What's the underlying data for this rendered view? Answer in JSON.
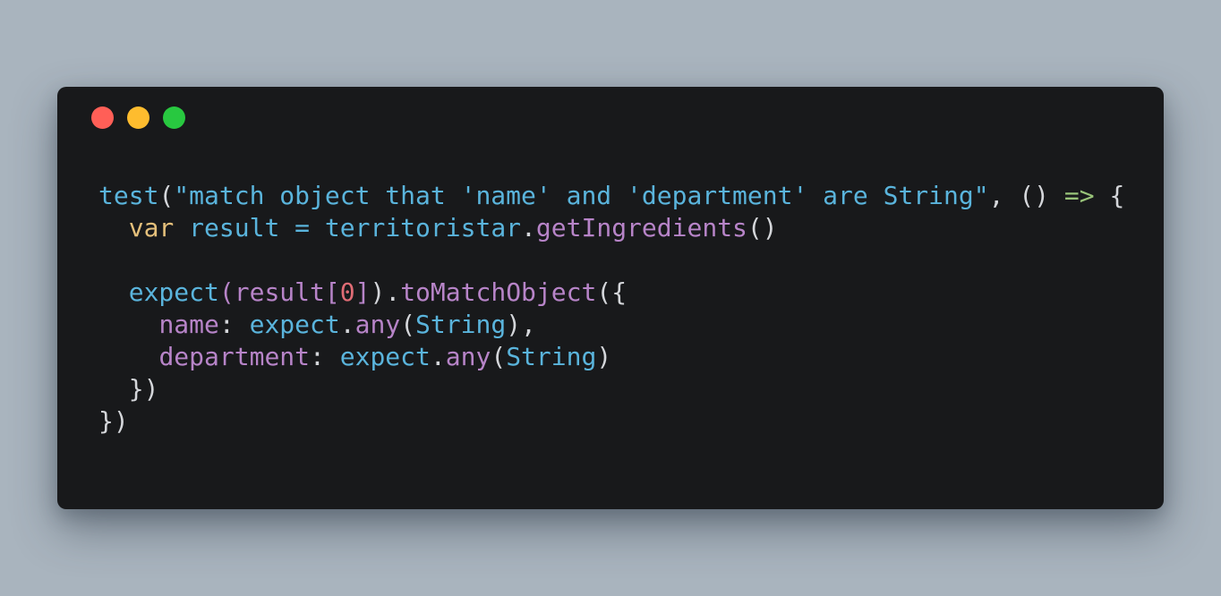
{
  "window": {
    "controls": [
      {
        "name": "close",
        "color": "#ff5f57"
      },
      {
        "name": "minimize",
        "color": "#febc2e"
      },
      {
        "name": "zoom",
        "color": "#28c840"
      }
    ]
  },
  "colors": {
    "background": "#a9b4be",
    "editor_background": "#18191b",
    "plain": "#d4d6da",
    "function": "#5ab4dc",
    "string": "#5ab4dc",
    "keyword": "#e5c07b",
    "method": "#b784c8",
    "arrow": "#98c379",
    "number": "#e06c75"
  },
  "code": {
    "lines": [
      [
        {
          "t": "test",
          "c": "function"
        },
        {
          "t": "(",
          "c": "plain"
        },
        {
          "t": "\"match object that 'name' and 'department' are String\"",
          "c": "string"
        },
        {
          "t": ", () ",
          "c": "plain"
        },
        {
          "t": "=>",
          "c": "arrow"
        },
        {
          "t": " {",
          "c": "plain"
        }
      ],
      [
        {
          "t": "  ",
          "c": "plain"
        },
        {
          "t": "var",
          "c": "keyword"
        },
        {
          "t": " ",
          "c": "plain"
        },
        {
          "t": "result",
          "c": "function"
        },
        {
          "t": " ",
          "c": "plain"
        },
        {
          "t": "=",
          "c": "function"
        },
        {
          "t": " ",
          "c": "plain"
        },
        {
          "t": "territoristar",
          "c": "function"
        },
        {
          "t": ".",
          "c": "plain"
        },
        {
          "t": "getIngredients",
          "c": "method"
        },
        {
          "t": "()",
          "c": "plain"
        }
      ],
      [],
      [
        {
          "t": "  ",
          "c": "plain"
        },
        {
          "t": "expect",
          "c": "function"
        },
        {
          "t": "(",
          "c": "method"
        },
        {
          "t": "result",
          "c": "method"
        },
        {
          "t": "[",
          "c": "method"
        },
        {
          "t": "0",
          "c": "number"
        },
        {
          "t": "]",
          "c": "method"
        },
        {
          "t": ")",
          "c": "plain"
        },
        {
          "t": ".",
          "c": "plain"
        },
        {
          "t": "toMatchObject",
          "c": "method"
        },
        {
          "t": "({",
          "c": "plain"
        }
      ],
      [
        {
          "t": "    ",
          "c": "plain"
        },
        {
          "t": "name",
          "c": "method"
        },
        {
          "t": ": ",
          "c": "plain"
        },
        {
          "t": "expect",
          "c": "function"
        },
        {
          "t": ".",
          "c": "plain"
        },
        {
          "t": "any",
          "c": "method"
        },
        {
          "t": "(",
          "c": "plain"
        },
        {
          "t": "String",
          "c": "function"
        },
        {
          "t": "),",
          "c": "plain"
        }
      ],
      [
        {
          "t": "    ",
          "c": "plain"
        },
        {
          "t": "department",
          "c": "method"
        },
        {
          "t": ": ",
          "c": "plain"
        },
        {
          "t": "expect",
          "c": "function"
        },
        {
          "t": ".",
          "c": "plain"
        },
        {
          "t": "any",
          "c": "method"
        },
        {
          "t": "(",
          "c": "plain"
        },
        {
          "t": "String",
          "c": "function"
        },
        {
          "t": ")",
          "c": "plain"
        }
      ],
      [
        {
          "t": "  })",
          "c": "plain"
        }
      ],
      [
        {
          "t": "})",
          "c": "plain"
        }
      ]
    ]
  }
}
